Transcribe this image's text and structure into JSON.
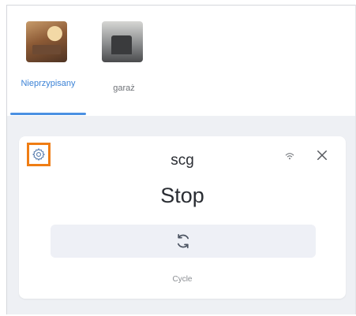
{
  "tabs": [
    {
      "label": "Nieprzypisany",
      "thumbnail": "living-room-photo",
      "selected": true
    },
    {
      "label": "garaż",
      "thumbnail": "garage-photo",
      "selected": false
    }
  ],
  "card": {
    "title": "scg",
    "state": "Stop",
    "cycle_label": "Cycle",
    "icons": {
      "settings": "gear-icon",
      "wifi": "wifi-icon",
      "close": "close-icon",
      "cycle": "refresh-icon"
    }
  },
  "colors": {
    "accent": "#4a90e2",
    "highlight_box": "#ef7d14",
    "background": "#eef0f4",
    "card": "#ffffff",
    "text": "#2a2d33"
  }
}
